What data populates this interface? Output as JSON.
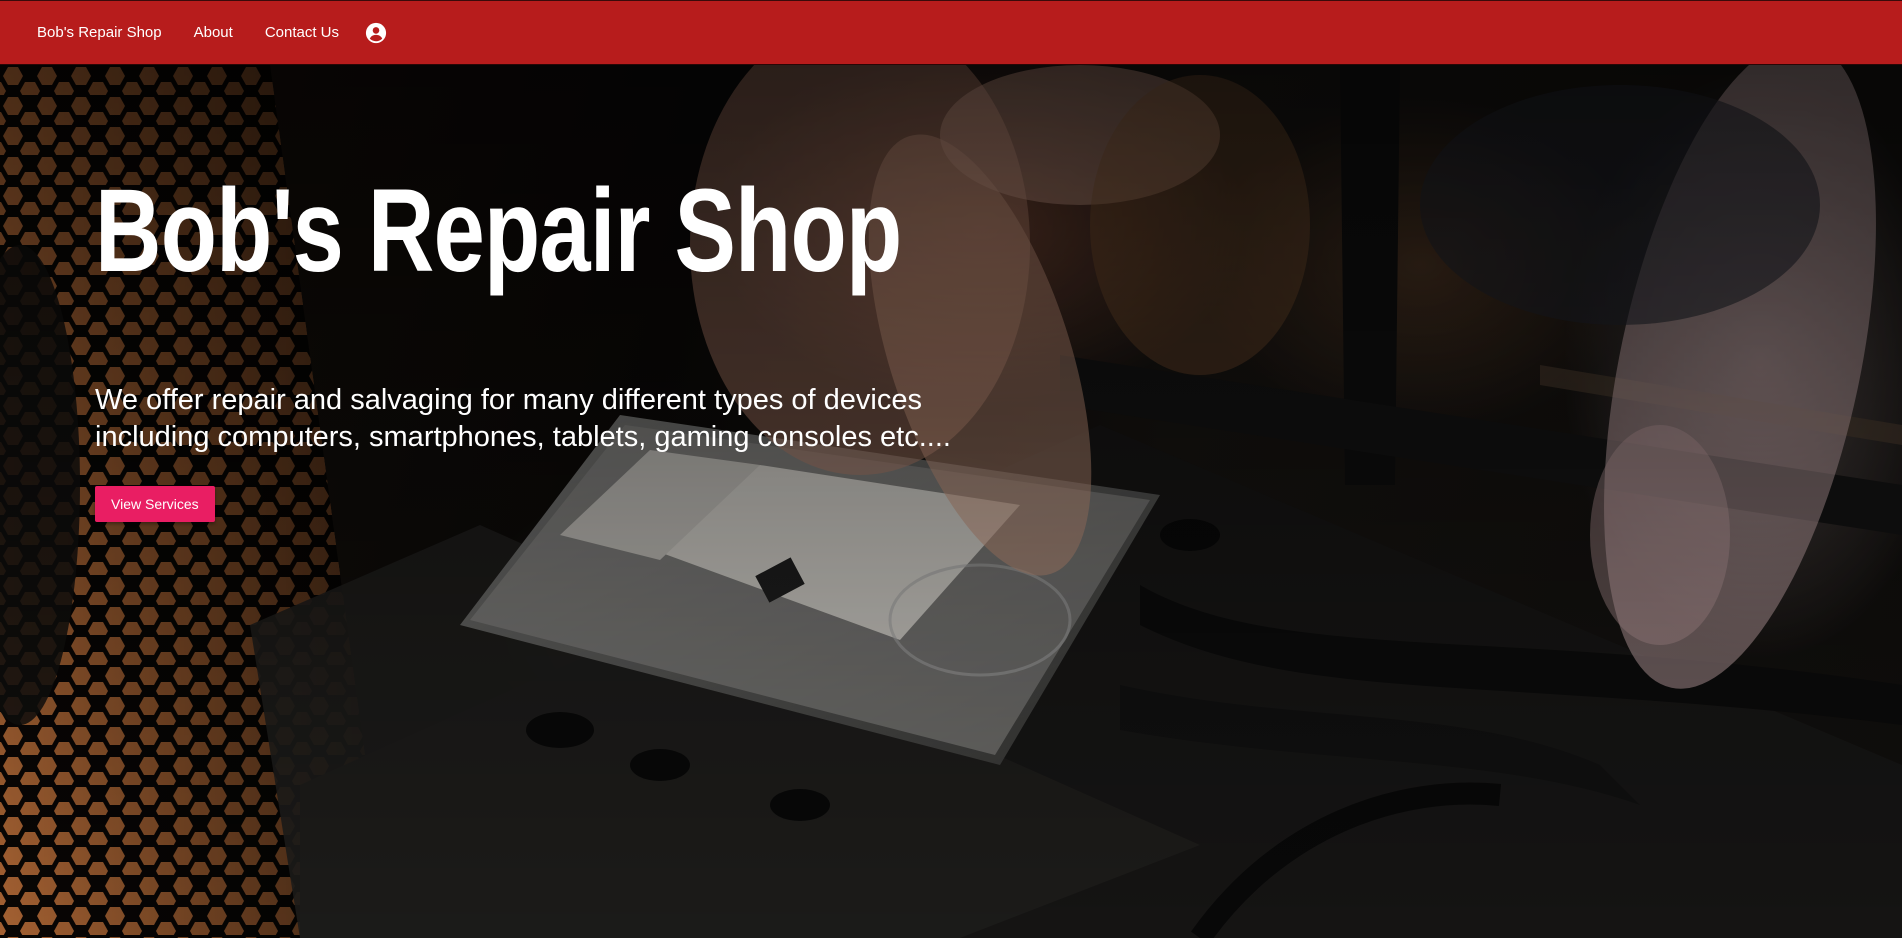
{
  "nav": {
    "brand": "Bob's Repair Shop",
    "about": "About",
    "contact": "Contact Us",
    "account_icon": "account-circle-icon"
  },
  "hero": {
    "title": "Bob's Repair Shop",
    "description": "We offer repair and salvaging for many different types of devices including computers, smartphones, tablets, gaming consoles etc....",
    "button_label": "View Services",
    "background_image": "computer-repair-hard-drive-photo"
  },
  "colors": {
    "navbar": "#b71c1c",
    "button": "#e91e63",
    "text": "#ffffff"
  }
}
